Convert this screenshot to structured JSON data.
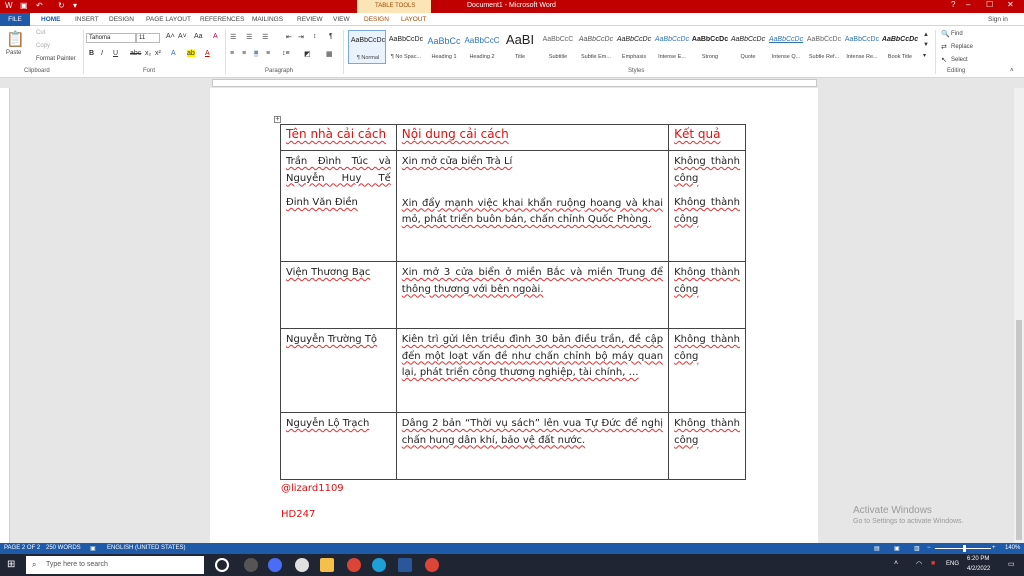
{
  "titlebar": {
    "title": "Document1 - Microsoft Word",
    "table_tools": "TABLE TOOLS",
    "sign_in": "Sign in",
    "window_buttons": [
      "?",
      "–",
      "☐",
      "✕"
    ]
  },
  "ribbon_tabs": [
    "FILE",
    "HOME",
    "INSERT",
    "DESIGN",
    "PAGE LAYOUT",
    "REFERENCES",
    "MAILINGS",
    "REVIEW",
    "VIEW",
    "DESIGN",
    "LAYOUT"
  ],
  "clipboard": {
    "paste": "Paste",
    "cut": "Cut",
    "copy": "Copy",
    "format_painter": "Format Painter",
    "label": "Clipboard"
  },
  "font": {
    "name": "Tahoma",
    "size": "11",
    "label": "Font"
  },
  "paragraph": {
    "label": "Paragraph"
  },
  "styles": {
    "label": "Styles",
    "items": [
      {
        "preview": "AaBbCcDc",
        "name": "¶ Normal"
      },
      {
        "preview": "AaBbCcDc",
        "name": "¶ No Spac..."
      },
      {
        "preview": "AaBbCc",
        "name": "Heading 1"
      },
      {
        "preview": "AaBbCcC",
        "name": "Heading 2"
      },
      {
        "preview": "AaBI",
        "name": "Title"
      },
      {
        "preview": "AaBbCcC",
        "name": "Subtitle"
      },
      {
        "preview": "AaBbCcDc",
        "name": "Subtle Em..."
      },
      {
        "preview": "AaBbCcDc",
        "name": "Emphasis"
      },
      {
        "preview": "AaBbCcDc",
        "name": "Intense E..."
      },
      {
        "preview": "AaBbCcDc",
        "name": "Strong"
      },
      {
        "preview": "AaBbCcDc",
        "name": "Quote"
      },
      {
        "preview": "AaBbCcDc",
        "name": "Intense Q..."
      },
      {
        "preview": "AaBbCcDc",
        "name": "Subtle Ref..."
      },
      {
        "preview": "AaBbCcDc",
        "name": "Intense Re..."
      },
      {
        "preview": "AaBbCcDc",
        "name": "Book Title"
      }
    ]
  },
  "editing": {
    "find": "Find",
    "replace": "Replace",
    "select": "Select",
    "label": "Editing"
  },
  "table": {
    "headers": [
      "Tên nhà cải cách",
      "Nội dung cải cách",
      "Kết quả"
    ],
    "rows": [
      {
        "name_lines": [
          "Trần Đình Túc và Nguyễn Huy Tế",
          "Đinh Văn Điền"
        ],
        "content_lines": [
          "Xin mở cửa biển Trà Lí",
          "Xin đẩy mạnh việc khai khẩn ruộng hoang và khai mỏ, phát triển buôn bán, chấn chỉnh Quốc Phòng."
        ],
        "result_lines": [
          "Không thành công",
          "Không thành công"
        ]
      },
      {
        "name_lines": [
          "Viện Thương Bạc"
        ],
        "content_lines": [
          "Xin mở 3 cửa biển ở miền Bắc và miền Trung để thông thương với bên ngoài."
        ],
        "result_lines": [
          "Không thành công"
        ]
      },
      {
        "name_lines": [
          "Nguyễn Trường Tộ"
        ],
        "content_lines": [
          "Kiên trì gửi lên triều đình 30 bản điều trần, đề cập đến một loạt vấn đề như chấn chỉnh bộ máy quan lại, phát triển công thương nghiệp, tài chính, …"
        ],
        "result_lines": [
          "Không thành công"
        ]
      },
      {
        "name_lines": [
          "Nguyễn Lộ Trạch"
        ],
        "content_lines": [
          "Dâng 2 bản “Thời vụ sách” lên vua Tự Đức để nghị chấn hung dân khí, bảo vệ đất nước."
        ],
        "result_lines": [
          "Không thành công"
        ]
      }
    ]
  },
  "footer_lines": [
    "@lizard1109",
    "HD247"
  ],
  "activate": {
    "title": "Activate Windows",
    "subtitle": "Go to Settings to activate Windows."
  },
  "status": {
    "page": "PAGE 2 OF 2",
    "words": "250 WORDS",
    "language": "ENGLISH (UNITED STATES)",
    "zoom": "140%"
  },
  "taskbar": {
    "search_placeholder": "Type here to search",
    "time": "6:20 PM",
    "date": "4/2/2022",
    "lang": "ENG"
  }
}
